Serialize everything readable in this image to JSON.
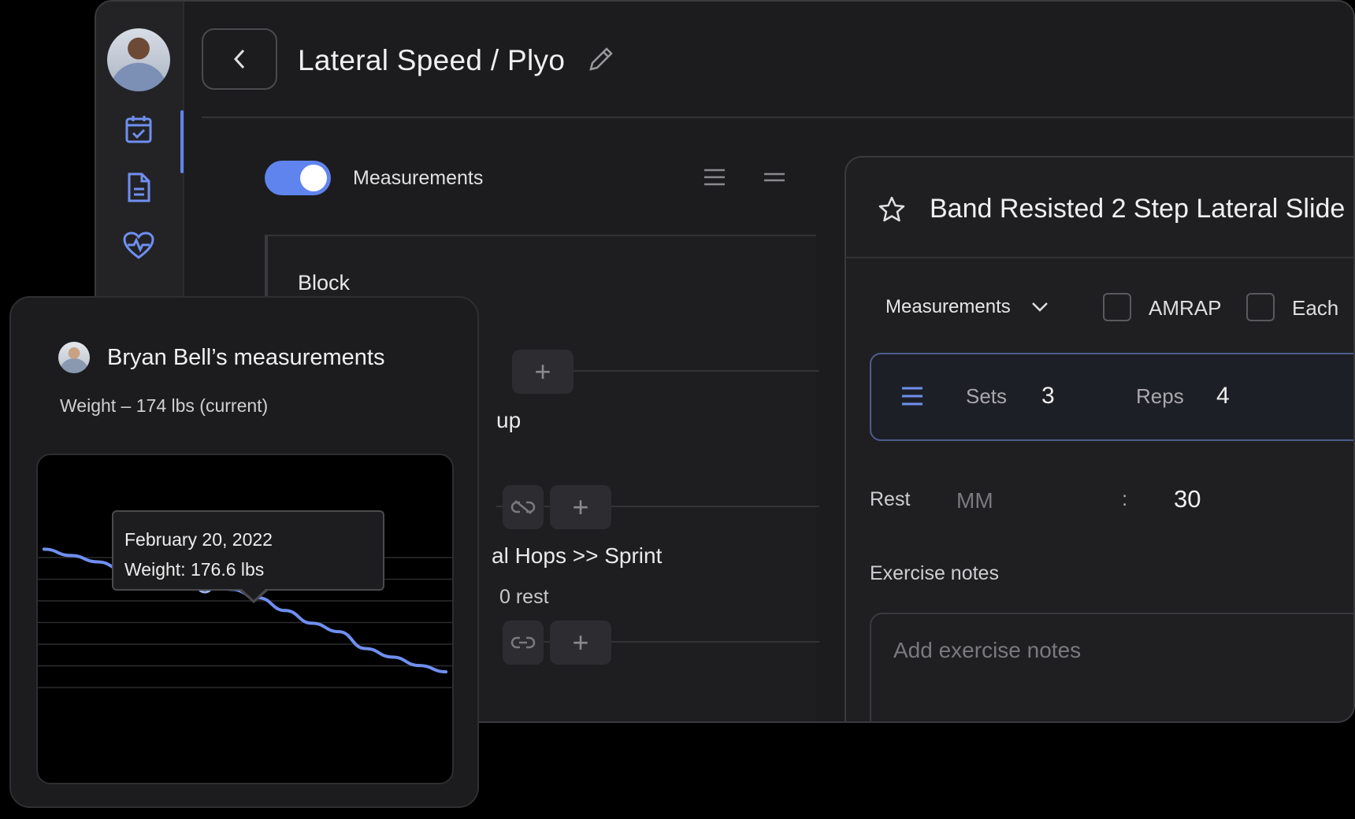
{
  "header": {
    "title": "Lateral Speed / Plyo"
  },
  "sidebar": {
    "items": [
      {
        "icon": "calendar-check-icon"
      },
      {
        "icon": "document-icon"
      },
      {
        "icon": "heart-pulse-icon"
      }
    ]
  },
  "toolbar": {
    "toggle_label": "Measurements"
  },
  "block": {
    "title": "Block",
    "group_partial": "up",
    "exercise_partial": "al Hops >> Sprint",
    "rest_partial": "0 rest"
  },
  "exercise": {
    "title": "Band Resisted 2 Step Lateral Slide",
    "select_label": "Measurements",
    "amrap_label": "AMRAP",
    "each_label": "Each",
    "sets_label": "Sets",
    "sets_value": "3",
    "reps_label": "Reps",
    "reps_value": "4",
    "rest_label": "Rest",
    "rest_minutes_placeholder": "MM",
    "rest_colon": ":",
    "rest_seconds": "30",
    "notes_label": "Exercise notes",
    "notes_placeholder": "Add exercise notes"
  },
  "measurements": {
    "title": "Bryan Bell’s measurements",
    "subtitle": "Weight – 174 lbs (current)",
    "tooltip_date": "February 20, 2022",
    "tooltip_value": "Weight: 176.6 lbs"
  },
  "chart_data": {
    "type": "line",
    "title": "",
    "xlabel": "",
    "ylabel": "",
    "grid": true,
    "series": [
      {
        "values": [
          178.3,
          178.0,
          177.7,
          177.3,
          177.0,
          176.8,
          176.6,
          176.4,
          176.0,
          175.4,
          174.8,
          174.4,
          173.6,
          173.2,
          172.8,
          172.5
        ]
      }
    ],
    "ylim": [
      168,
      182
    ],
    "highlight_index": 6,
    "line_color": "#6f8ff0"
  },
  "colors": {
    "accent": "#5f84ee",
    "background": "#1c1c1e"
  }
}
